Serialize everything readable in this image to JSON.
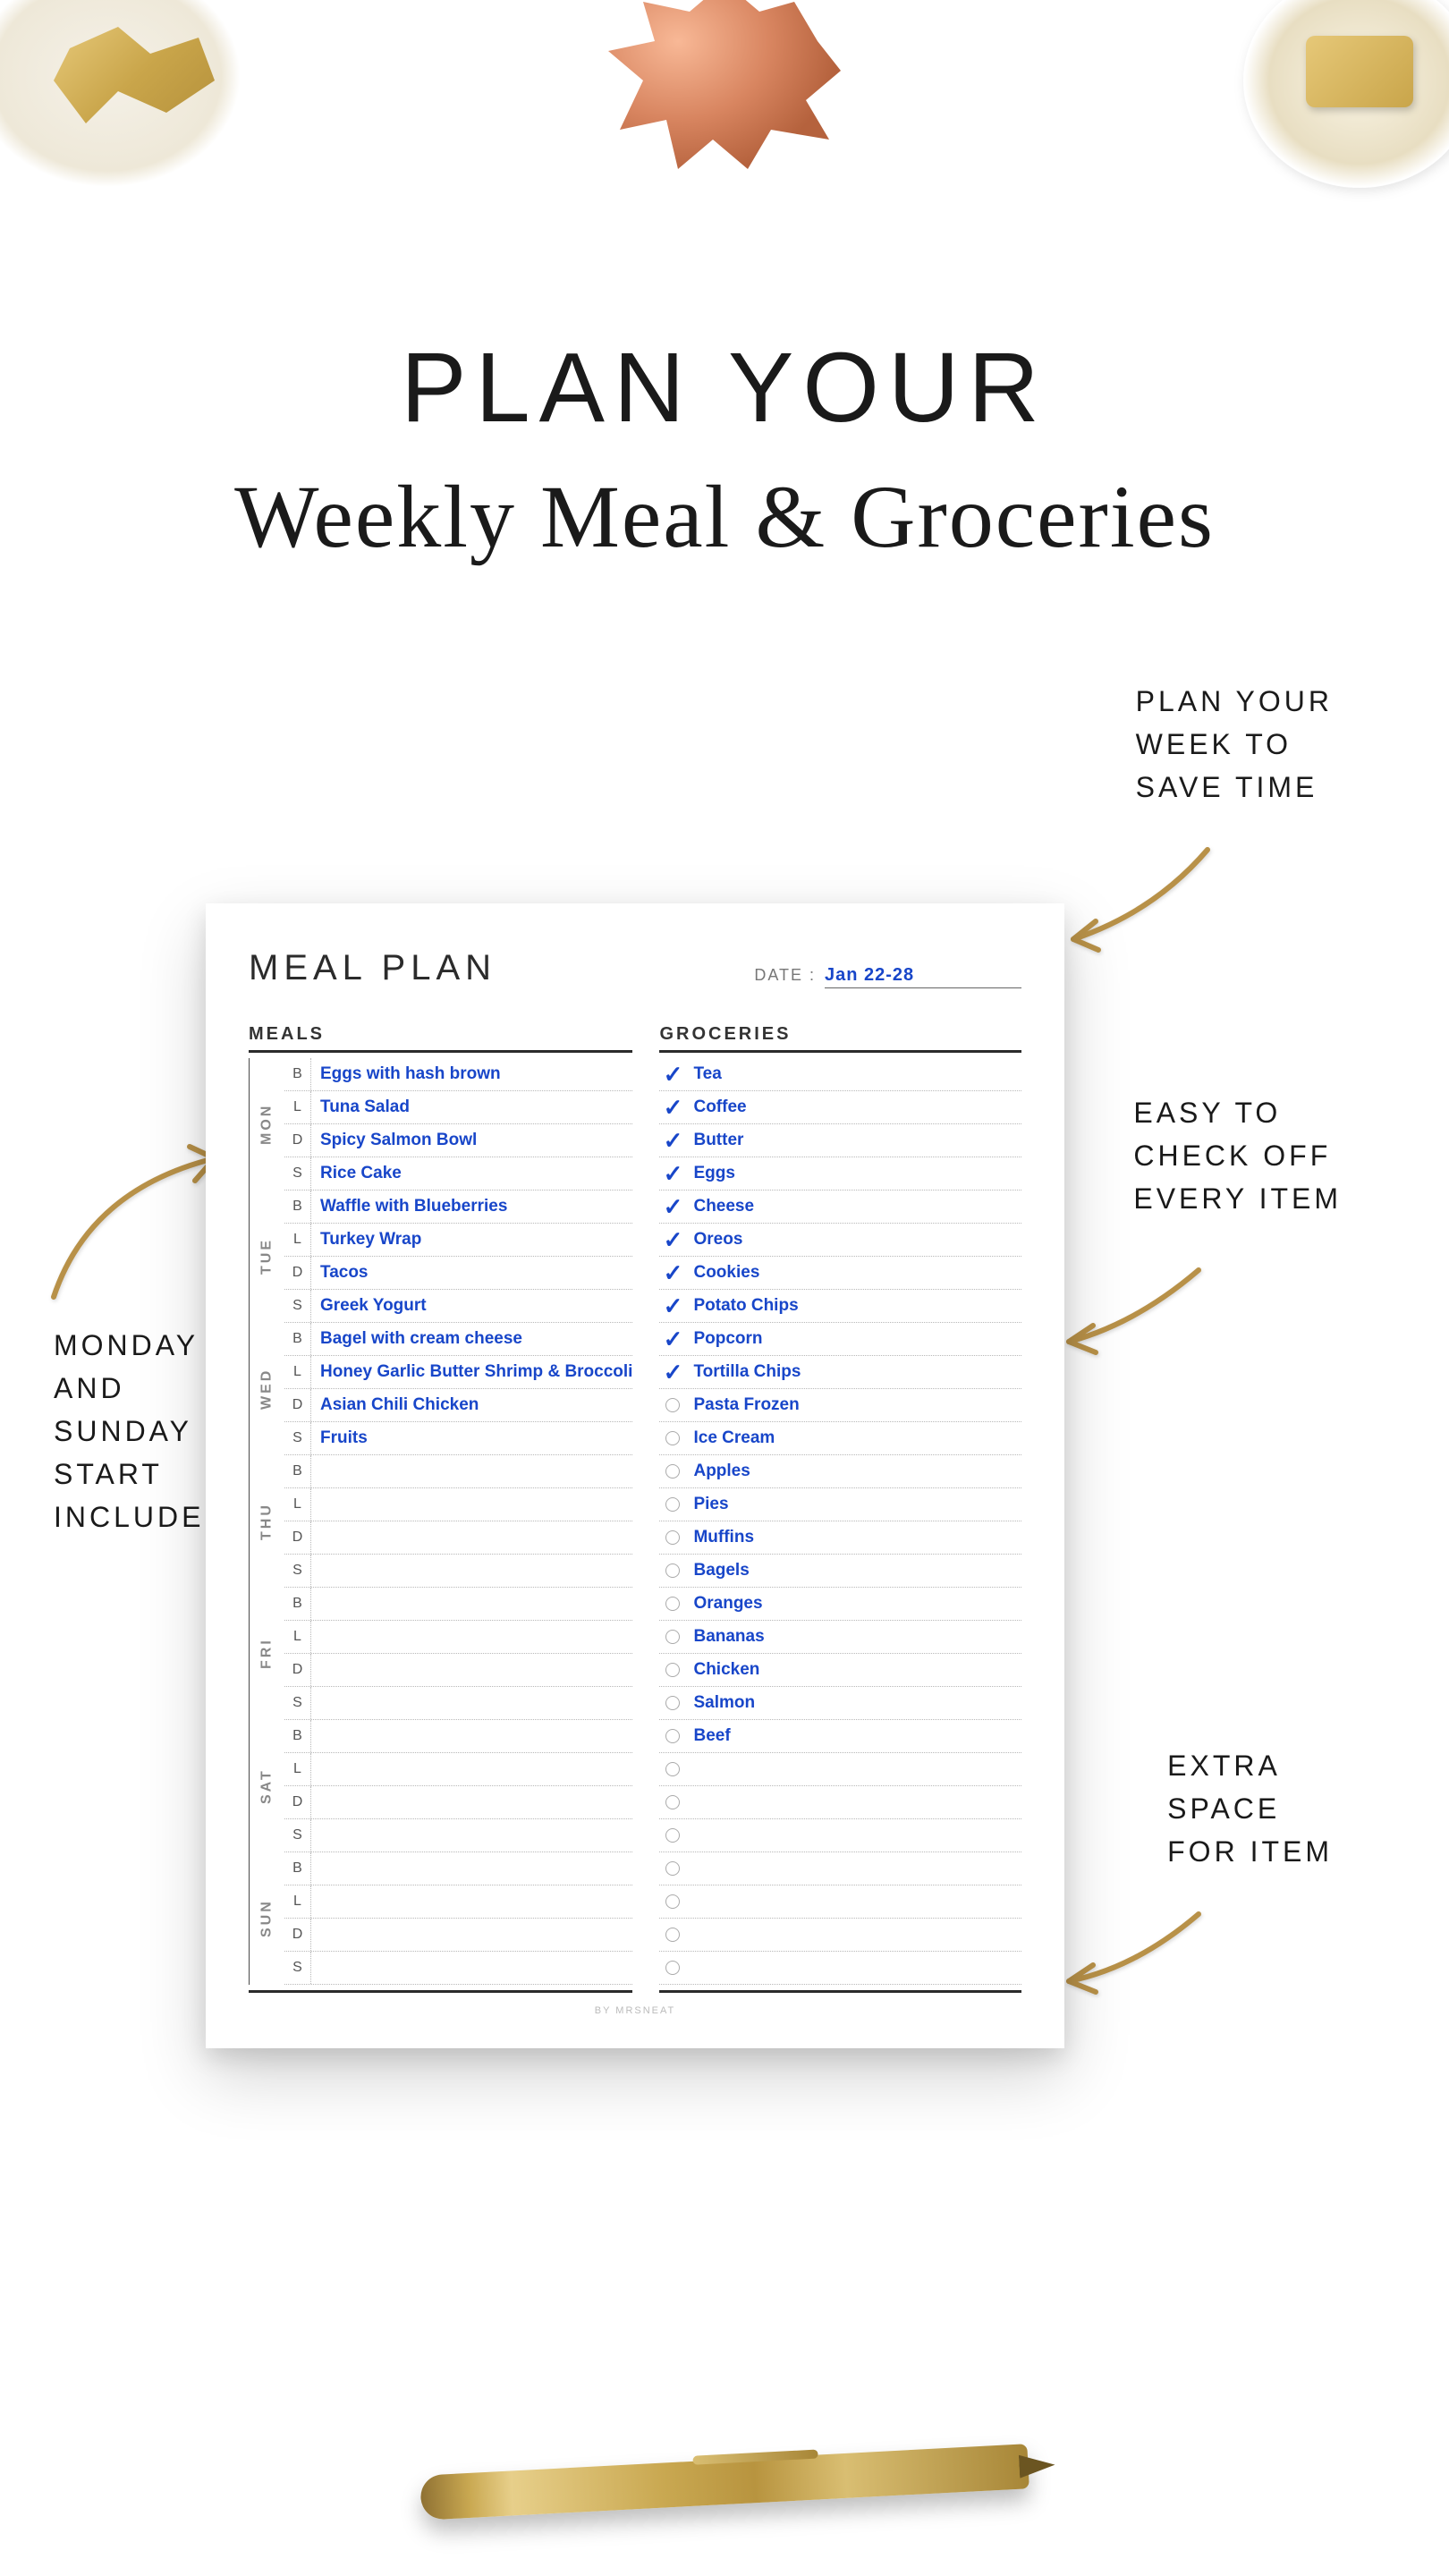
{
  "headline": "PLAN YOUR",
  "subheadline": "Weekly Meal & Groceries",
  "callouts": {
    "top_right": "PLAN YOUR\nWEEK TO\nSAVE TIME",
    "mid_right": "EASY TO\nCHECK OFF\nEVERY ITEM",
    "bot_right": "EXTRA\nSPACE\nFOR ITEM",
    "left": "MONDAY\nAND\nSUNDAY\nSTART\nINCLUDED"
  },
  "planner": {
    "title": "MEAL PLAN",
    "date_label": "DATE :",
    "date_value": "Jan 22-28",
    "meals_label": "MEALS",
    "groceries_label": "GROCERIES",
    "footer": "BY MRSNEAT",
    "slot_keys": [
      "B",
      "L",
      "D",
      "S"
    ],
    "days": [
      {
        "label": "MON",
        "meals": [
          "Eggs with hash brown",
          "Tuna Salad",
          "Spicy Salmon Bowl",
          "Rice Cake"
        ]
      },
      {
        "label": "TUE",
        "meals": [
          "Waffle with Blueberries",
          "Turkey Wrap",
          "Tacos",
          "Greek Yogurt"
        ]
      },
      {
        "label": "WED",
        "meals": [
          "Bagel with cream cheese",
          "Honey Garlic Butter Shrimp & Broccoli",
          "Asian Chili Chicken",
          "Fruits"
        ]
      },
      {
        "label": "THU",
        "meals": [
          "",
          "",
          "",
          ""
        ]
      },
      {
        "label": "FRI",
        "meals": [
          "",
          "",
          "",
          ""
        ]
      },
      {
        "label": "SAT",
        "meals": [
          "",
          "",
          "",
          ""
        ]
      },
      {
        "label": "SUN",
        "meals": [
          "",
          "",
          "",
          ""
        ]
      }
    ],
    "groceries": [
      {
        "name": "Tea",
        "checked": true
      },
      {
        "name": "Coffee",
        "checked": true
      },
      {
        "name": "Butter",
        "checked": true
      },
      {
        "name": "Eggs",
        "checked": true
      },
      {
        "name": "Cheese",
        "checked": true
      },
      {
        "name": "Oreos",
        "checked": true
      },
      {
        "name": "Cookies",
        "checked": true
      },
      {
        "name": "Potato Chips",
        "checked": true
      },
      {
        "name": "Popcorn",
        "checked": true
      },
      {
        "name": "Tortilla Chips",
        "checked": true
      },
      {
        "name": "Pasta Frozen",
        "checked": false
      },
      {
        "name": "Ice Cream",
        "checked": false
      },
      {
        "name": "Apples",
        "checked": false
      },
      {
        "name": "Pies",
        "checked": false
      },
      {
        "name": "Muffins",
        "checked": false
      },
      {
        "name": "Bagels",
        "checked": false
      },
      {
        "name": "Oranges",
        "checked": false
      },
      {
        "name": "Bananas",
        "checked": false
      },
      {
        "name": "Chicken",
        "checked": false
      },
      {
        "name": "Salmon",
        "checked": false
      },
      {
        "name": "Beef",
        "checked": false
      },
      {
        "name": "",
        "checked": false
      },
      {
        "name": "",
        "checked": false
      },
      {
        "name": "",
        "checked": false
      },
      {
        "name": "",
        "checked": false
      },
      {
        "name": "",
        "checked": false
      },
      {
        "name": "",
        "checked": false
      },
      {
        "name": "",
        "checked": false
      }
    ]
  }
}
